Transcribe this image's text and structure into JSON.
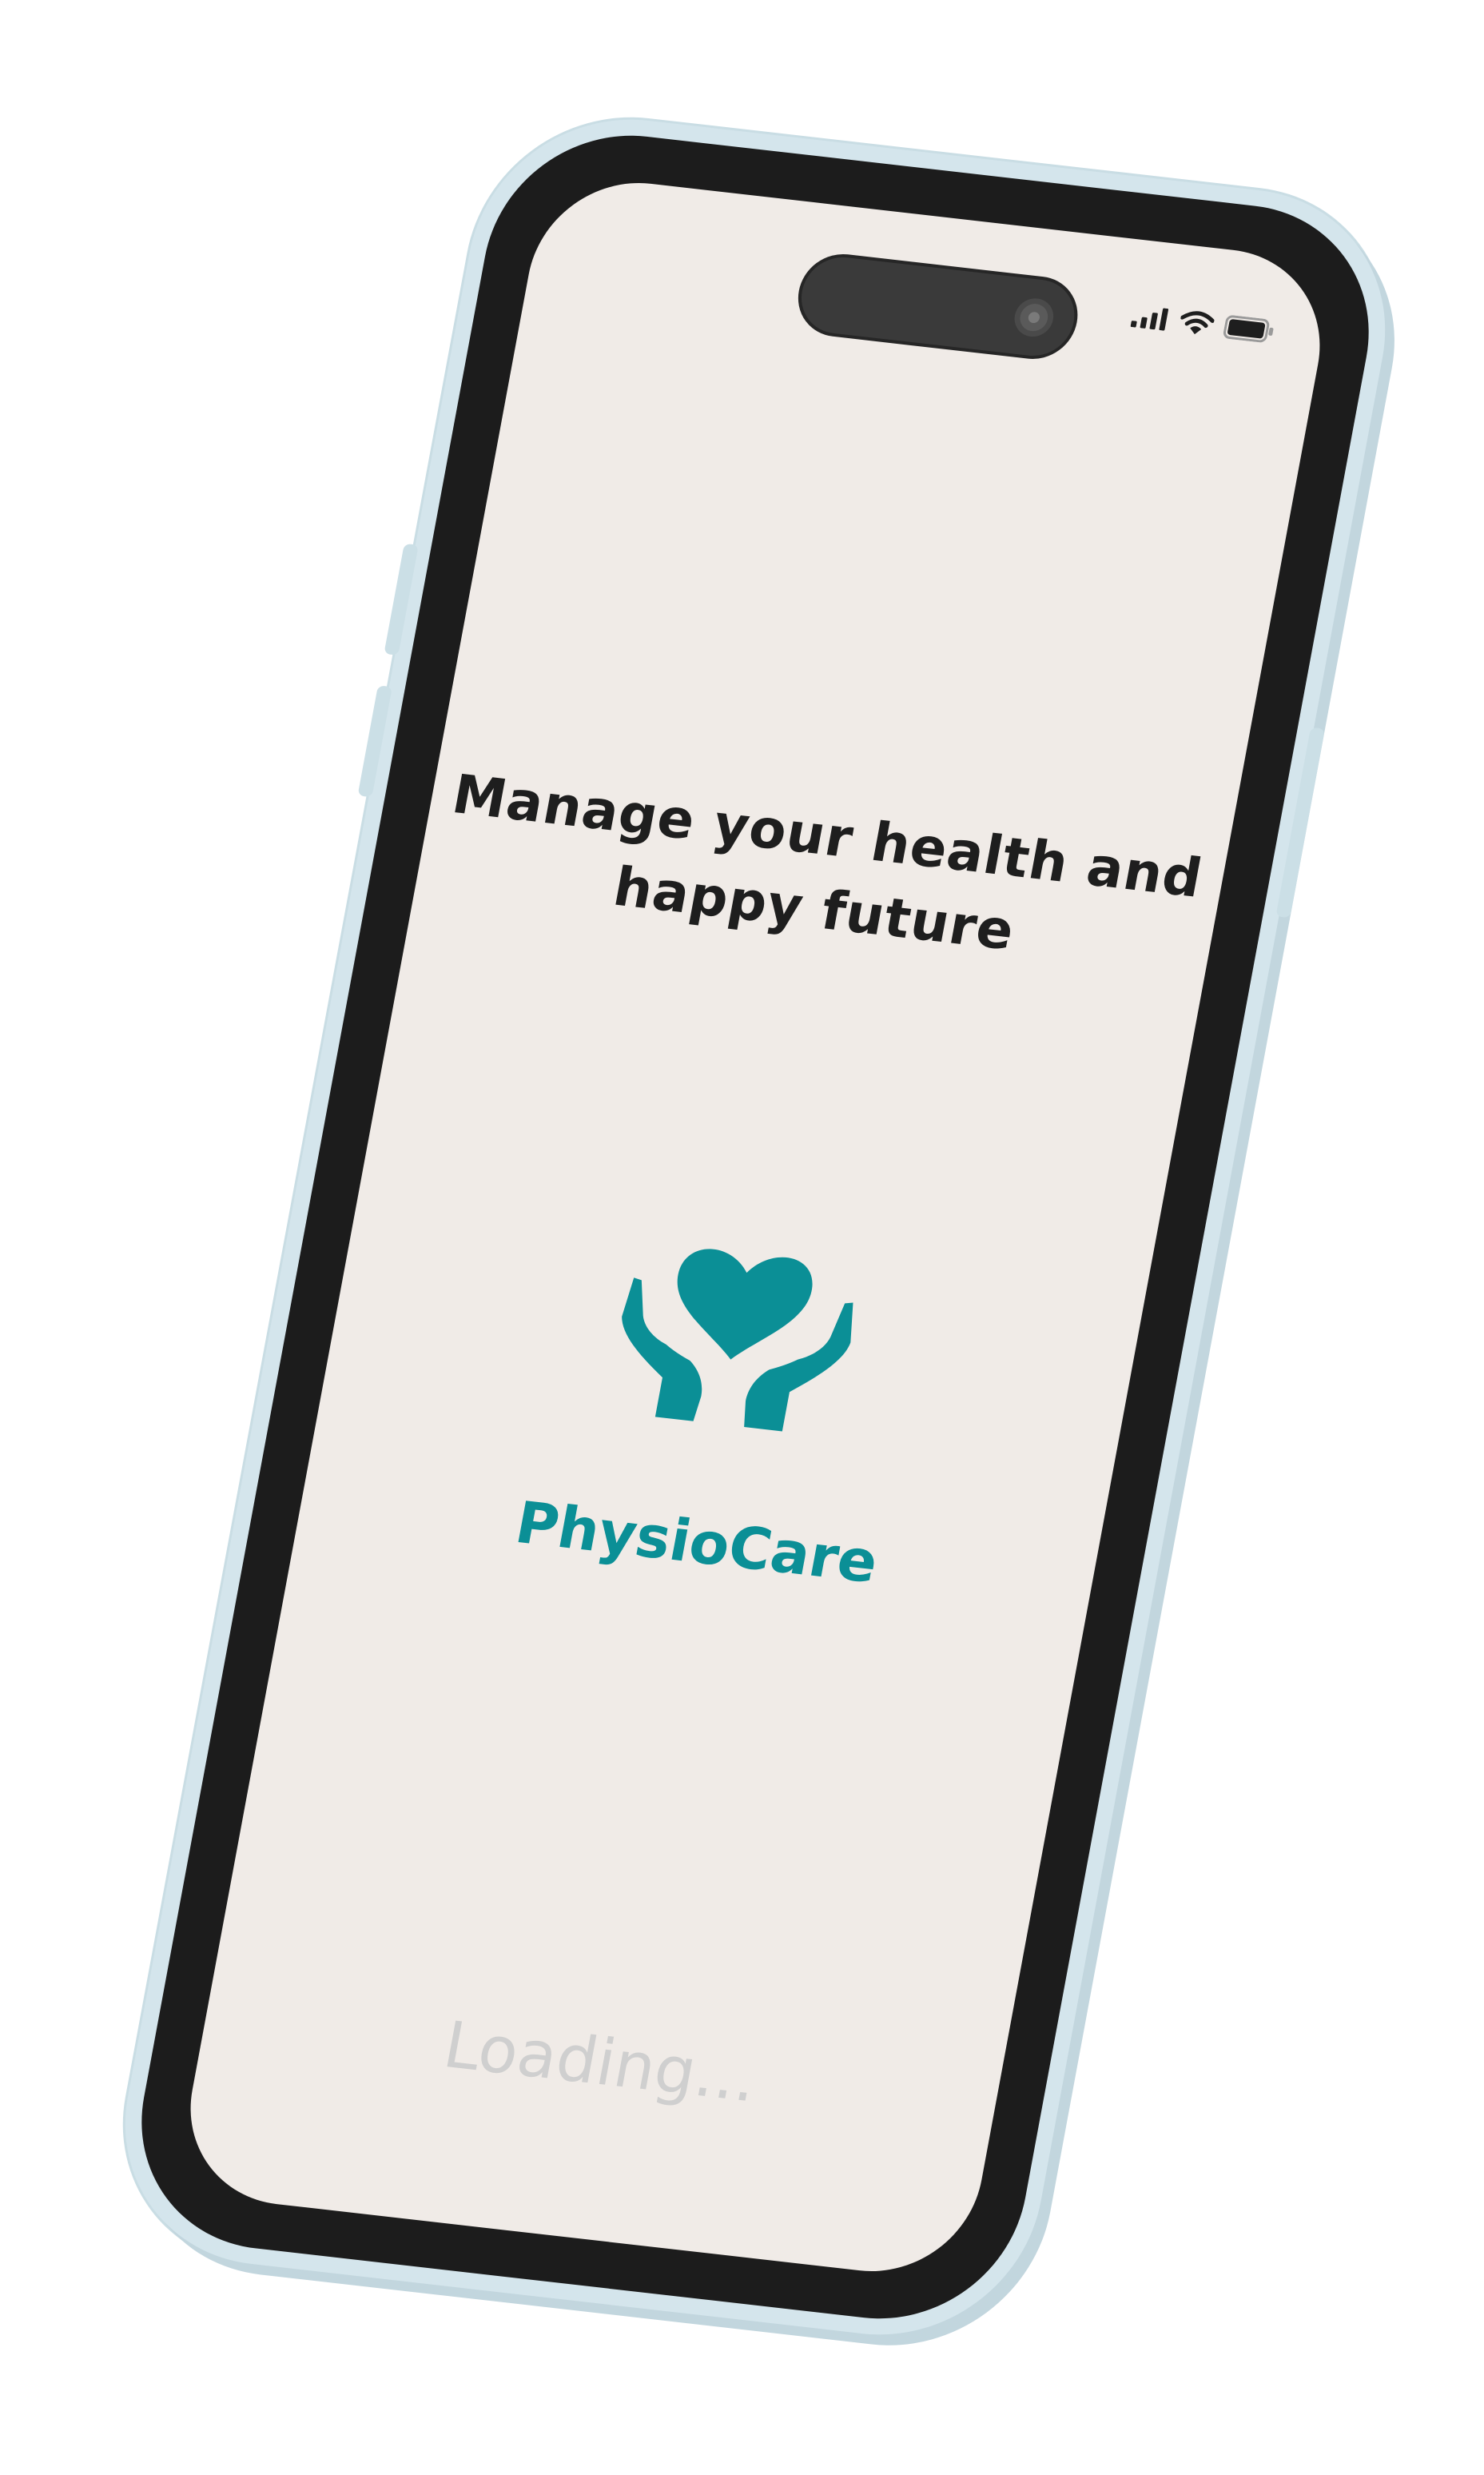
{
  "app": {
    "headline_line1": "Manage your health and",
    "headline_line2": "happy future",
    "brand_name": "PhysioCare",
    "loading_text": "Loading..."
  },
  "status_bar": {
    "icons": [
      "cellular-signal-icon",
      "wifi-icon",
      "battery-icon"
    ]
  },
  "logo": {
    "icon": "hands-holding-heart-icon"
  },
  "colors": {
    "screen_background": "#f0ebe7",
    "accent_teal": "#0b8f96",
    "headline_text": "#1e1e1e",
    "loading_text": "#cfcfcf",
    "phone_body": "#d4e5ec",
    "bezel": "#1c1c1c"
  }
}
